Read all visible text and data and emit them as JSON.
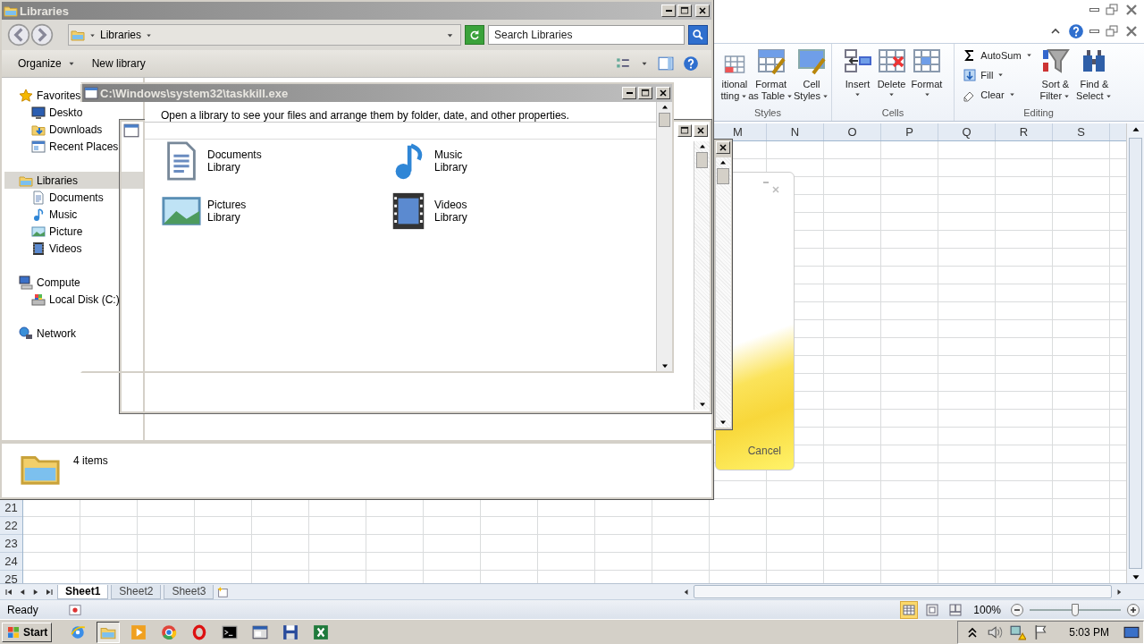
{
  "excel": {
    "ribbon": {
      "groups": [
        {
          "label": "Styles",
          "large": [
            {
              "kind": "conditional",
              "lines": [
                "itional",
                "tting"
              ]
            },
            {
              "kind": "table",
              "lines": [
                "Format",
                "as Table"
              ]
            },
            {
              "kind": "cell-styles",
              "lines": [
                "Cell",
                "Styles"
              ]
            }
          ]
        },
        {
          "label": "Cells",
          "large": [
            {
              "kind": "insert",
              "lines": [
                "Insert"
              ]
            },
            {
              "kind": "delete",
              "lines": [
                "Delete"
              ]
            },
            {
              "kind": "format",
              "lines": [
                "Format"
              ]
            }
          ]
        },
        {
          "label": "Editing",
          "small": [
            {
              "kind": "autosum",
              "label": "AutoSum"
            },
            {
              "kind": "fill",
              "label": "Fill"
            },
            {
              "kind": "clear",
              "label": "Clear"
            }
          ],
          "large": [
            {
              "kind": "sort",
              "lines": [
                "Sort &",
                "Filter"
              ]
            },
            {
              "kind": "find",
              "lines": [
                "Find &",
                "Select"
              ]
            }
          ]
        }
      ]
    },
    "columns": [
      "M",
      "N",
      "O",
      "P",
      "Q",
      "R",
      "S"
    ],
    "rows": [
      "21",
      "22",
      "23",
      "24",
      "25"
    ],
    "sheet_tabs": [
      {
        "label": "Sheet1",
        "selected": true
      },
      {
        "label": "Sheet2",
        "selected": false
      },
      {
        "label": "Sheet3",
        "selected": false
      }
    ],
    "status": "Ready",
    "views": [
      {
        "kind": "normal",
        "selected": true
      },
      {
        "kind": "page-layout",
        "selected": false
      },
      {
        "kind": "page-break",
        "selected": false
      }
    ],
    "zoom": {
      "reading": "100%",
      "level": 0.5
    }
  },
  "explorer": {
    "title": "Libraries",
    "address": "Libraries",
    "search": {
      "placeholder": "Search Libraries"
    },
    "toolbar": [
      {
        "label": "Organize",
        "menu": true
      },
      {
        "label": "New library",
        "menu": false
      }
    ],
    "nav": [
      {
        "label": "Favorites",
        "kind": "favorites",
        "selected": false,
        "children": [
          {
            "label": "Deskto",
            "kind": "desktop",
            "selected": false
          },
          {
            "label": "Downloads",
            "kind": "downloads",
            "selected": false
          },
          {
            "label": "Recent Places",
            "kind": "recent",
            "selected": false
          }
        ]
      },
      {
        "label": "Libraries",
        "kind": "libraries",
        "selected": true,
        "children": [
          {
            "label": "Documents",
            "kind": "documents",
            "selected": false
          },
          {
            "label": "Music",
            "kind": "music",
            "selected": false
          },
          {
            "label": "Picture",
            "kind": "pictures",
            "selected": false
          },
          {
            "label": "Videos",
            "kind": "videos",
            "selected": false
          }
        ]
      },
      {
        "label": "Compute",
        "kind": "computer",
        "selected": false,
        "children": [
          {
            "label": "Local Disk (C:)",
            "kind": "disk",
            "selected": false
          }
        ]
      },
      {
        "label": "Network",
        "kind": "network",
        "selected": false
      }
    ],
    "status": "4 items"
  },
  "taskkill": {
    "title": "C:\\Windows\\system32\\taskkill.exe",
    "hint": "Open a library to see your files and arrange them by folder, date, and other properties.",
    "libraries": [
      {
        "kind": "documents",
        "name": "Documents",
        "type": "Library"
      },
      {
        "kind": "music",
        "name": "Music",
        "type": "Library"
      },
      {
        "kind": "pictures",
        "name": "Pictures",
        "type": "Library"
      },
      {
        "kind": "videos",
        "name": "Videos",
        "type": "Library"
      }
    ]
  },
  "dialog": {
    "button": "Cancel"
  },
  "taskbar": {
    "start": "Start",
    "apps": [
      {
        "kind": "ie",
        "selected": false
      },
      {
        "kind": "explorer",
        "selected": true
      },
      {
        "kind": "media",
        "selected": false
      },
      {
        "kind": "chrome",
        "selected": false
      },
      {
        "kind": "opera",
        "selected": false
      },
      {
        "kind": "cmd",
        "selected": false
      },
      {
        "kind": "window",
        "selected": false
      },
      {
        "kind": "floppy",
        "selected": false
      },
      {
        "kind": "excel",
        "selected": false
      }
    ],
    "clock": "5:03 PM"
  }
}
